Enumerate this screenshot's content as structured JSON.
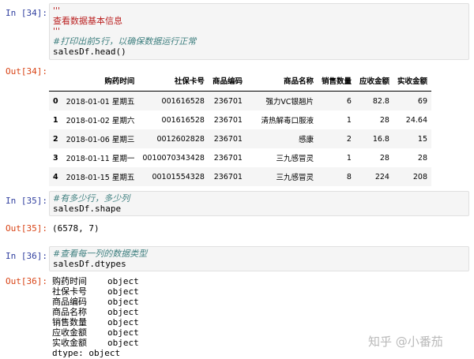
{
  "cells": [
    {
      "in_prompt": "In [34]:",
      "code_lines": [
        "'''",
        "查看数据基本信息",
        "'''",
        "#打印出前5行，以确保数据运行正常",
        "salesDf.head()"
      ],
      "out_prompt": "Out[34]:"
    },
    {
      "in_prompt": "In [35]:",
      "code_lines": [
        "#有多少行，多少列",
        "salesDf.shape"
      ],
      "out_prompt": "Out[35]:",
      "output": "(6578, 7)"
    },
    {
      "in_prompt": "In [36]:",
      "code_lines": [
        "#查看每一列的数据类型",
        "salesDf.dtypes"
      ],
      "out_prompt": "Out[36]:"
    }
  ],
  "table": {
    "columns": [
      "",
      "购药时间",
      "社保卡号",
      "商品编码",
      "商品名称",
      "销售数量",
      "应收金额",
      "实收金额"
    ],
    "rows": [
      [
        "0",
        "2018-01-01 星期五",
        "001616528",
        "236701",
        "强力VC银翘片",
        "6",
        "82.8",
        "69"
      ],
      [
        "1",
        "2018-01-02 星期六",
        "001616528",
        "236701",
        "清热解毒口服液",
        "1",
        "28",
        "24.64"
      ],
      [
        "2",
        "2018-01-06 星期三",
        "0012602828",
        "236701",
        "感康",
        "2",
        "16.8",
        "15"
      ],
      [
        "3",
        "2018-01-11 星期一",
        "0010070343428",
        "236701",
        "三九感冒灵",
        "1",
        "28",
        "28"
      ],
      [
        "4",
        "2018-01-15 星期五",
        "00101554328",
        "236701",
        "三九感冒灵",
        "8",
        "224",
        "208"
      ]
    ]
  },
  "dtypes": [
    {
      "name": "购药时间",
      "type": "object"
    },
    {
      "name": "社保卡号",
      "type": "object"
    },
    {
      "name": "商品编码",
      "type": "object"
    },
    {
      "name": "商品名称",
      "type": "object"
    },
    {
      "name": "销售数量",
      "type": "object"
    },
    {
      "name": "应收金额",
      "type": "object"
    },
    {
      "name": "实收金额",
      "type": "object"
    }
  ],
  "dtype_footer": "dtype: object",
  "watermark": "知乎 @小番茄"
}
